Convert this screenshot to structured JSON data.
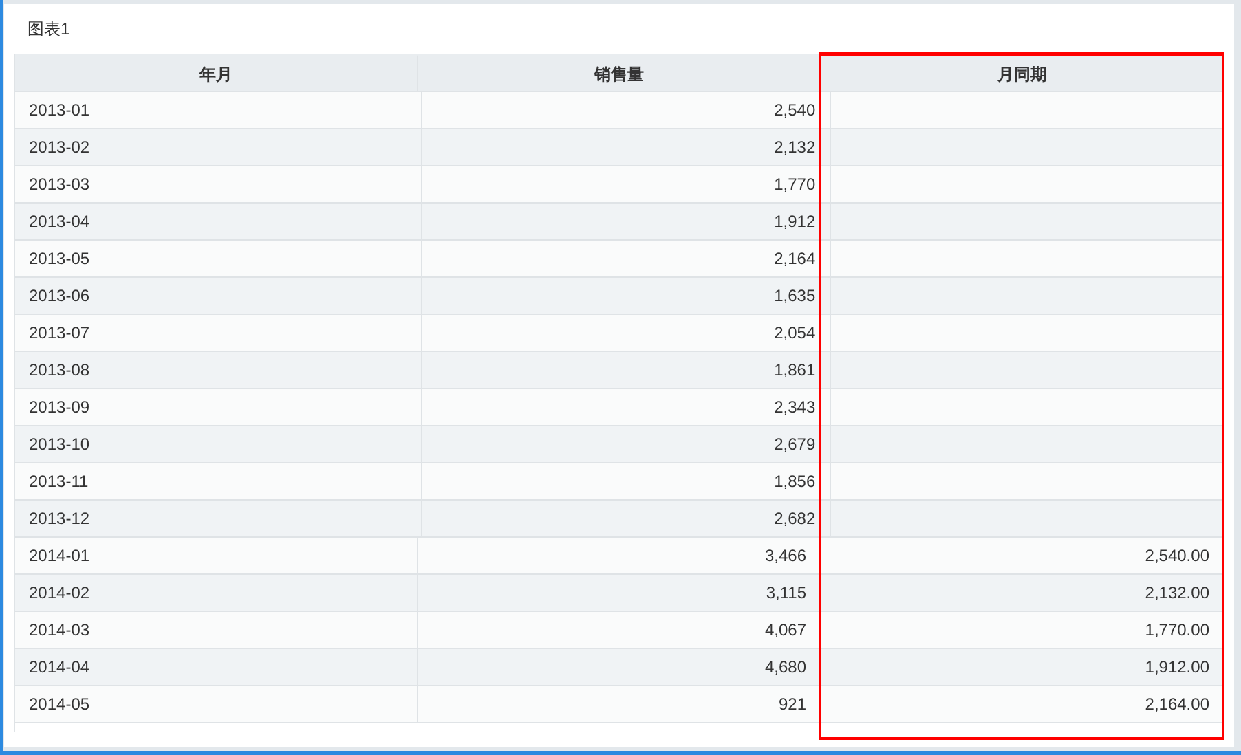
{
  "panel": {
    "title": "图表1"
  },
  "table": {
    "columns": [
      {
        "label": "年月",
        "highlighted": false
      },
      {
        "label": "销售量",
        "highlighted": false
      },
      {
        "label": "月同期",
        "highlighted": true
      }
    ],
    "rows": [
      {
        "month": "2013-01",
        "sales": "2,540"
      },
      {
        "month": "2013-02",
        "sales": "2,132"
      },
      {
        "month": "2013-03",
        "sales": "1,770"
      },
      {
        "month": "2013-04",
        "sales": "1,912"
      },
      {
        "month": "2013-05",
        "sales": "2,164"
      },
      {
        "month": "2013-06",
        "sales": "1,635"
      },
      {
        "month": "2013-07",
        "sales": "2,054"
      },
      {
        "month": "2013-08",
        "sales": "1,861"
      },
      {
        "month": "2013-09",
        "sales": "2,343"
      },
      {
        "month": "2013-10",
        "sales": "2,679"
      },
      {
        "month": "2013-11",
        "sales": "1,856"
      },
      {
        "month": "2013-12",
        "sales": "2,682"
      },
      {
        "month": "2014-01",
        "sales": "3,466",
        "same_month_last_year": "2,540.00"
      },
      {
        "month": "2014-02",
        "sales": "3,115",
        "same_month_last_year": "2,132.00"
      },
      {
        "month": "2014-03",
        "sales": "4,067",
        "same_month_last_year": "1,770.00"
      },
      {
        "month": "2014-04",
        "sales": "4,680",
        "same_month_last_year": "1,912.00"
      },
      {
        "month": "2014-05",
        "sales": "921",
        "same_month_last_year": "2,164.00"
      }
    ]
  }
}
